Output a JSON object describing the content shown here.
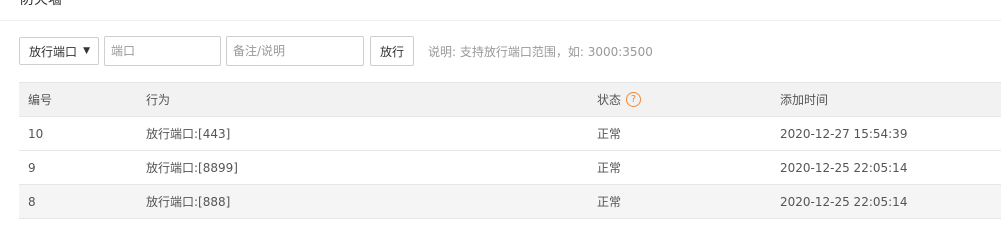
{
  "header": {
    "title": "防火墙"
  },
  "toolbar": {
    "select_value": "放行端口",
    "port_placeholder": "端口",
    "remark_placeholder": "备注/说明",
    "submit_label": "放行",
    "hint": "说明: 支持放行端口范围，如: 3000:3500"
  },
  "table": {
    "columns": [
      "编号",
      "行为",
      "状态",
      "添加时间"
    ],
    "status_help_icon": "question-circle-icon",
    "rows": [
      {
        "id": "10",
        "action": "放行端口:[443]",
        "status": "正常",
        "time": "2020-12-27 15:54:39"
      },
      {
        "id": "9",
        "action": "放行端口:[8899]",
        "status": "正常",
        "time": "2020-12-25 22:05:14"
      },
      {
        "id": "8",
        "action": "放行端口:[888]",
        "status": "正常",
        "time": "2020-12-25 22:05:14"
      }
    ]
  },
  "colors": {
    "accent_orange": "#f0883a",
    "header_bg": "#f2f2f2",
    "border": "#e6e6e6"
  }
}
